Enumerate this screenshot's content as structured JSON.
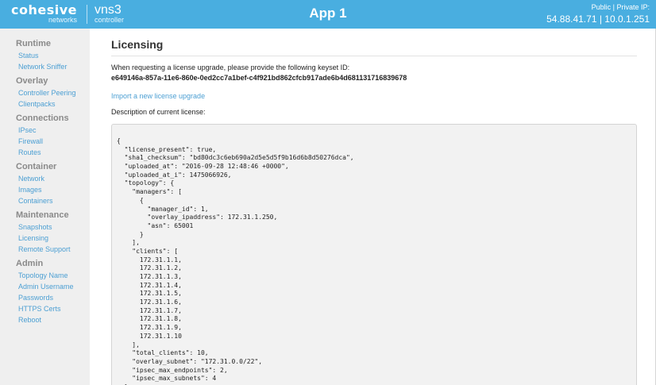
{
  "header": {
    "logo_main": "cohesive",
    "logo_sub": "networks",
    "product_main": "vns3",
    "product_sub": "controller",
    "app_title": "App 1",
    "ip_label": "Public | Private IP:",
    "ip_values": "54.88.41.71 | 10.0.1.251"
  },
  "sidebar": {
    "sections": [
      {
        "heading": "Runtime",
        "items": [
          "Status",
          "Network Sniffer"
        ]
      },
      {
        "heading": "Overlay",
        "items": [
          "Controller Peering",
          "Clientpacks"
        ]
      },
      {
        "heading": "Connections",
        "items": [
          "IPsec",
          "Firewall",
          "Routes"
        ]
      },
      {
        "heading": "Container",
        "items": [
          "Network",
          "Images",
          "Containers"
        ]
      },
      {
        "heading": "Maintenance",
        "items": [
          "Snapshots",
          "Licensing",
          "Remote Support"
        ]
      },
      {
        "heading": "Admin",
        "items": [
          "Topology Name",
          "Admin Username",
          "Passwords",
          "HTTPS Certs",
          "Reboot"
        ]
      }
    ]
  },
  "main": {
    "title": "Licensing",
    "keyset_intro": "When requesting a license upgrade, please provide the following keyset ID:",
    "keyset_id": "e649146a-857a-11e6-860e-0ed2cc7a1bef-c4f921bd862cfcb917ade6b4d681131716839678",
    "import_link": "Import a new license upgrade",
    "desc_label": "Description of current license:",
    "code_lines": [
      "{",
      "  \"license_present\": true,",
      "  \"sha1_checksum\": \"bd80dc3c6eb690a2d5e5d5f9b16d6b8d50276dca\",",
      "  \"uploaded_at\": \"2016-09-28 12:48:46 +0000\",",
      "  \"uploaded_at_i\": 1475066926,",
      "  \"topology\": {",
      "    \"managers\": [",
      "      {",
      "        \"manager_id\": 1,",
      "        \"overlay_ipaddress\": 172.31.1.250,",
      "        \"asn\": 65001",
      "      }",
      "    ],",
      "    \"clients\": [",
      "      172.31.1.1,",
      "      172.31.1.2,",
      "      172.31.1.3,",
      "      172.31.1.4,",
      "      172.31.1.5,",
      "      172.31.1.6,",
      "      172.31.1.7,",
      "      172.31.1.8,",
      "      172.31.1.9,",
      "      172.31.1.10",
      "    ],",
      "    \"total_clients\": 10,",
      "    \"overlay_subnet\": \"172.31.0.0/22\",",
      "    \"ipsec_max_endpoints\": 2,",
      "    \"ipsec_max_subnets\": 4",
      "  },"
    ]
  }
}
